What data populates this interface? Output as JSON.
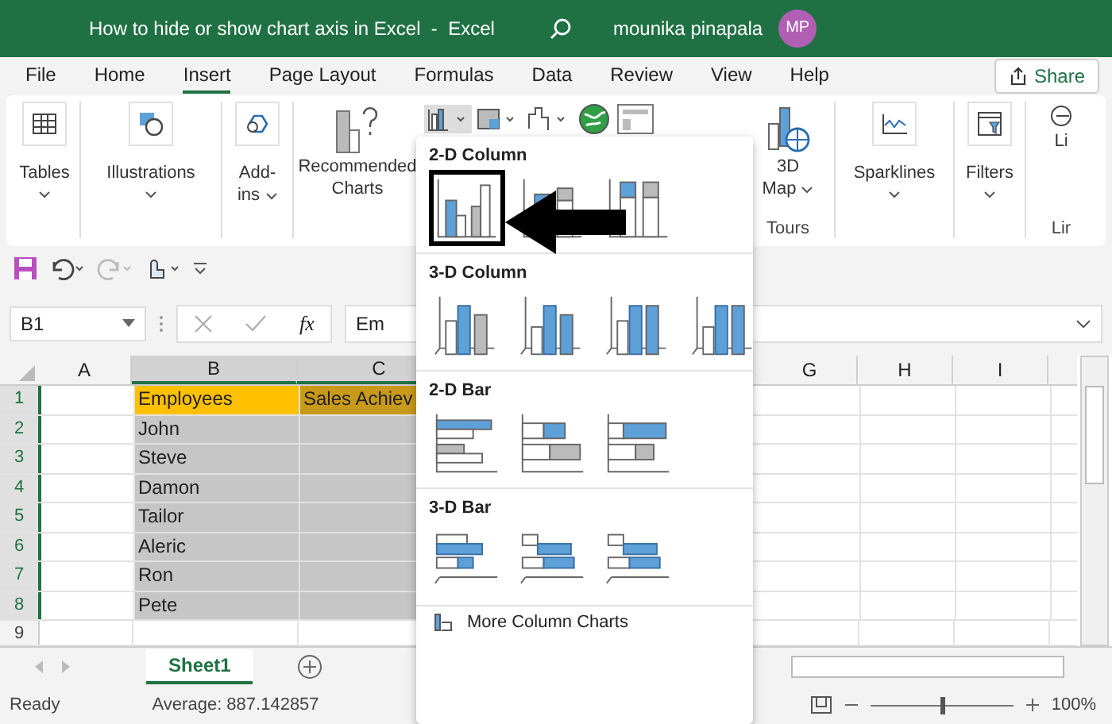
{
  "window": {
    "title": "How to hide or show chart axis in Excel  -  Excel",
    "user": "mounika pinapala",
    "avatar": "MP"
  },
  "tabs": [
    {
      "label": "File",
      "selected": false
    },
    {
      "label": "Home",
      "selected": false
    },
    {
      "label": "Insert",
      "selected": true
    },
    {
      "label": "Page Layout",
      "selected": false
    },
    {
      "label": "Formulas",
      "selected": false
    },
    {
      "label": "Data",
      "selected": false
    },
    {
      "label": "Review",
      "selected": false
    },
    {
      "label": "View",
      "selected": false
    },
    {
      "label": "Help",
      "selected": false
    }
  ],
  "share": "Share",
  "ribbon": {
    "tables": "Tables",
    "illustrations": "Illustrations",
    "addins": [
      "Add-",
      "ins"
    ],
    "recommended": [
      "Recommended",
      "Charts"
    ],
    "map": [
      "3D",
      "Map"
    ],
    "tours": "Tours",
    "sparklines": "Sparklines",
    "filters": "Filters",
    "links": "Li",
    "links_group": "Lir"
  },
  "name_box": "B1",
  "fx": "fx",
  "formula": "Em",
  "columns": [
    {
      "label": "A",
      "selected": false
    },
    {
      "label": "B",
      "selected": true
    },
    {
      "label": "C",
      "selected": true
    },
    {
      "label": "G",
      "selected": false
    },
    {
      "label": "H",
      "selected": false
    },
    {
      "label": "I",
      "selected": false
    }
  ],
  "rows": [
    {
      "num": "1",
      "selected": true,
      "b": "Employees",
      "c": "Sales Achiev",
      "kind": "header"
    },
    {
      "num": "2",
      "selected": true,
      "b": "John",
      "kind": "data"
    },
    {
      "num": "3",
      "selected": true,
      "b": "Steve",
      "kind": "data"
    },
    {
      "num": "4",
      "selected": true,
      "b": "Damon",
      "kind": "data"
    },
    {
      "num": "5",
      "selected": true,
      "b": "Tailor",
      "kind": "data"
    },
    {
      "num": "6",
      "selected": true,
      "b": "Aleric",
      "kind": "data"
    },
    {
      "num": "7",
      "selected": true,
      "b": "Ron",
      "kind": "data"
    },
    {
      "num": "8",
      "selected": true,
      "b": "Pete",
      "kind": "data"
    },
    {
      "num": "9",
      "selected": false,
      "kind": "data"
    }
  ],
  "sheets": [
    {
      "label": "Sheet1",
      "selected": true
    }
  ],
  "status": {
    "text": "Ready",
    "average": "Average: 887.142857",
    "zoom": "100%",
    "level": 0.5
  },
  "dropdown": {
    "sections": [
      {
        "title": "2-D Column",
        "kind": "col2d",
        "items": [
          {
            "highlighted": true
          },
          {
            "highlighted": false
          },
          {
            "highlighted": false
          }
        ]
      },
      {
        "title": "3-D Column",
        "kind": "col3d",
        "items": [
          {
            "highlighted": false
          },
          {
            "highlighted": false
          },
          {
            "highlighted": false
          },
          {
            "highlighted": false
          }
        ]
      },
      {
        "title": "2-D Bar",
        "kind": "bar2d",
        "items": [
          {
            "highlighted": false
          },
          {
            "highlighted": false
          },
          {
            "highlighted": false
          }
        ]
      },
      {
        "title": "3-D Bar",
        "kind": "bar3d",
        "items": [
          {
            "highlighted": false
          },
          {
            "highlighted": false
          },
          {
            "highlighted": false
          }
        ]
      }
    ],
    "more": "More Column Charts"
  }
}
